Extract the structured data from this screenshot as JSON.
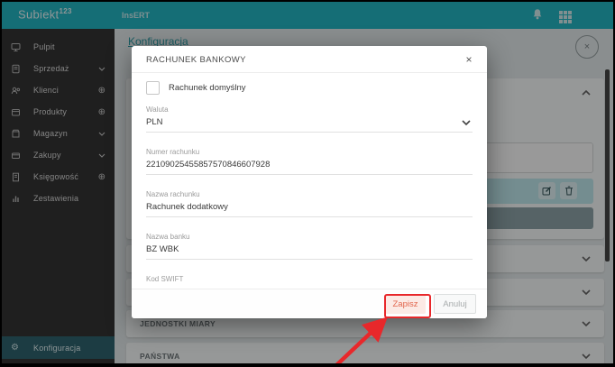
{
  "app": {
    "logo_text": "Subiekt",
    "logo_sup": "123",
    "brand": "InsERT"
  },
  "header_icons": {
    "bell": "bell-icon",
    "apps": "apps-grid-icon"
  },
  "sidebar": {
    "items": [
      {
        "label": "Pulpit",
        "icon": "desktop-icon",
        "suffix": "none"
      },
      {
        "label": "Sprzedaż",
        "icon": "sales-icon",
        "suffix": "chevron-down"
      },
      {
        "label": "Klienci",
        "icon": "clients-icon",
        "suffix": "plus-circle"
      },
      {
        "label": "Produkty",
        "icon": "products-icon",
        "suffix": "plus-circle"
      },
      {
        "label": "Magazyn",
        "icon": "warehouse-icon",
        "suffix": "chevron-down"
      },
      {
        "label": "Zakupy",
        "icon": "purchases-icon",
        "suffix": "chevron-down"
      },
      {
        "label": "Księgowość",
        "icon": "accounting-icon",
        "suffix": "plus-circle"
      },
      {
        "label": "Zestawienia",
        "icon": "reports-icon",
        "suffix": "none"
      }
    ],
    "footer": {
      "label": "Konfiguracja",
      "gear_glyph": "⚙"
    },
    "plus_glyph": "⊕"
  },
  "page": {
    "title": "Konfiguracja",
    "close_glyph": "×",
    "accordion": [
      {
        "label": ""
      },
      {
        "label": ""
      },
      {
        "label": "JEDNOSTKI MIARY"
      },
      {
        "label": "PAŃSTWA"
      }
    ]
  },
  "modal": {
    "title": "RACHUNEK BANKOWY",
    "close_glyph": "×",
    "checkbox": {
      "label": "Rachunek domyślny",
      "checked": false
    },
    "fields": [
      {
        "label": "Waluta",
        "value": "PLN",
        "type": "select"
      },
      {
        "label": "Numer rachunku",
        "value": "22109025455857570846607928",
        "type": "text"
      },
      {
        "label": "Nazwa rachunku",
        "value": "Rachunek dodatkowy",
        "type": "text"
      },
      {
        "label": "Nazwa banku",
        "value": "BZ WBK",
        "type": "text"
      },
      {
        "label": "Kod SWIFT",
        "value": "",
        "type": "text"
      }
    ],
    "buttons": {
      "save": "Zapisz",
      "cancel": "Anuluj"
    }
  },
  "colors": {
    "header_teal": "#23b7c5",
    "sidebar_bg": "#353535",
    "sidebar_active_bg": "#2f6570",
    "selected_row": "#c2ecf0",
    "dark_button": "#8fa6aa",
    "title_link": "#2a9aa4",
    "annotation_red": "#e8282b"
  }
}
